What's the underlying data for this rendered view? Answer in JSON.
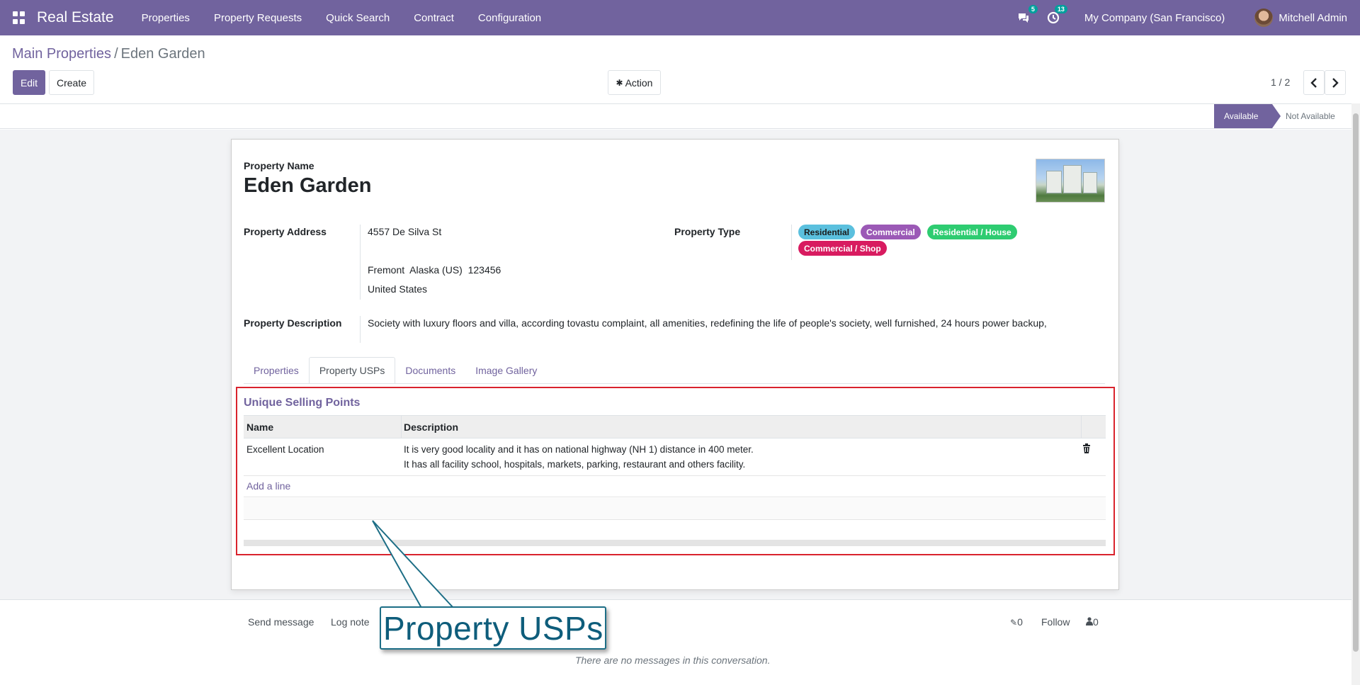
{
  "navbar": {
    "app_title": "Real Estate",
    "menu": [
      "Properties",
      "Property Requests",
      "Quick Search",
      "Contract",
      "Configuration"
    ],
    "messages_badge": "5",
    "activities_badge": "13",
    "company": "My Company (San Francisco)",
    "user": "Mitchell Admin"
  },
  "breadcrumb": {
    "parent": "Main Properties",
    "separator": "/",
    "current": "Eden Garden"
  },
  "buttons": {
    "edit": "Edit",
    "create": "Create",
    "action": "Action"
  },
  "pager": {
    "text": "1 / 2"
  },
  "status": {
    "active": "Available",
    "other": "Not Available"
  },
  "form": {
    "name_label": "Property Name",
    "name": "Eden Garden",
    "address_label": "Property Address",
    "address": {
      "street": "4557 De Silva St",
      "city_line": "Fremont  Alaska (US)  123456",
      "country": "United States"
    },
    "type_label": "Property Type",
    "type_tags": [
      {
        "label": "Residential",
        "color": "#5bc0de"
      },
      {
        "label": "Commercial",
        "color": "#9b59b6"
      },
      {
        "label": "Residential / House",
        "color": "#2ecc71"
      },
      {
        "label": "Commercial / Shop",
        "color": "#d81b60"
      }
    ],
    "description_label": "Property Description",
    "description": "Society with luxury floors and villa, according tovastu complaint, all amenities, redefining the life of people's society, well furnished, 24 hours power backup,"
  },
  "tabs": [
    "Properties",
    "Property USPs",
    "Documents",
    "Image Gallery"
  ],
  "usp": {
    "title": "Unique Selling Points",
    "columns": [
      "Name",
      "Description"
    ],
    "rows": [
      {
        "name": "Excellent Location",
        "desc_line1": "It is very good locality and it has on national highway (NH 1) distance in 400 meter.",
        "desc_line2": "It has all facility school, hospitals, markets, parking, restaurant and others facility."
      }
    ],
    "add_line": "Add a line"
  },
  "chatter": {
    "send_message": "Send message",
    "log_note": "Log note",
    "attachments": "0",
    "follow": "Follow",
    "followers": "0",
    "empty": "There are no messages in this conversation."
  },
  "callout": {
    "text": "Property USPs"
  },
  "colors": {
    "brand": "#71639e",
    "highlight_border": "#d9232d",
    "callout": "#0e5d7b"
  }
}
